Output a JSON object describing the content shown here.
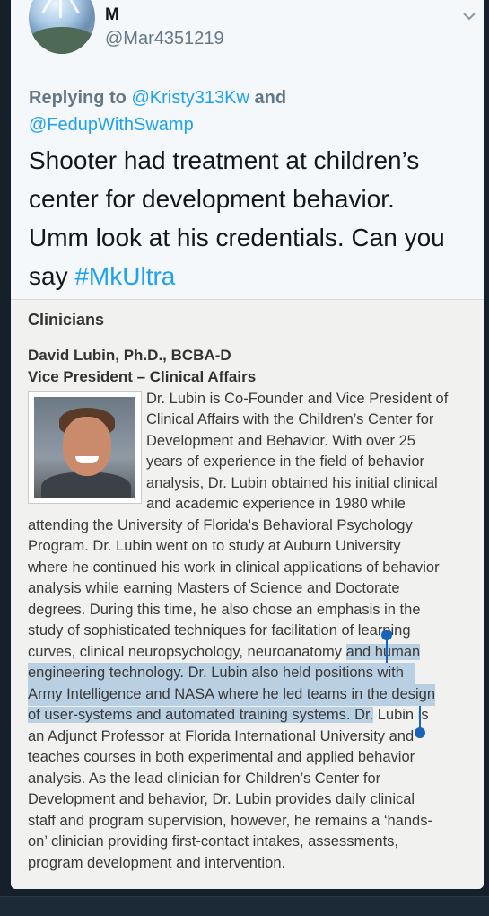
{
  "tweet": {
    "user_name": "M",
    "handle": "@Mar4351219",
    "replying_label": "Replying to",
    "reply_mention_1": "@Kristy313Kw",
    "reply_and": "and",
    "reply_mention_2": "@FedupWithSwamp",
    "text_line_1": "Shooter had treatment at children’s",
    "text_line_2": "center for development behavior.",
    "text_line_3": "Umm look at his credentials.  Can you",
    "text_line_4_prefix": "say ",
    "hashtag": "#MkUltra",
    "icons": {
      "avatar": "avatar",
      "menu": "chevron-down-icon"
    },
    "colors": {
      "link": "#1da1f2",
      "background": "#15202b",
      "card": "#f5f8fa"
    }
  },
  "document": {
    "section": "Clinicians",
    "name": "David Lubin, Ph.D., BCBA-D",
    "role": "Vice President – Clinical Affairs",
    "lines": [
      "Dr. Lubin is Co-Founder and Vice President of",
      "Clinical Affairs with the Children’s Center for",
      "Development and Behavior.  With over 25",
      "years of experience in the field of behavior",
      "analysis, Dr. Lubin obtained his initial clinical",
      "and academic experience in 1980 while",
      "attending the University of Florida's Behavioral Psychology",
      "Program.  Dr. Lubin went on to study at Auburn University",
      "where he continued his work in clinical applications of behavior",
      "analysis while earning Masters of Science and Doctorate",
      "degrees. During this time, he also chose an emphasis in the",
      "study of sophisticated techniques for facilitation of learning",
      "curves, clinical neuropsychology, neuroanatomy ",
      "and human",
      "engineering technology. Dr. Lubin also held positions with",
      "Army Intelligence and NASA where he led teams in the design",
      "of user-systems and automated training systems. Dr.",
      " Lubin is",
      "an Adjunct Professor at Florida International University and",
      "teaches courses in both experimental and applied behavior",
      "analysis. As the lead clinician for Children’s Center for",
      "Development and behavior, Dr. Lubin provides daily clinical",
      "staff and program supervision, however, he remains a ‘hands-",
      "on’ clinician providing first-contact intakes, assessments,",
      "program development and intervention."
    ]
  }
}
